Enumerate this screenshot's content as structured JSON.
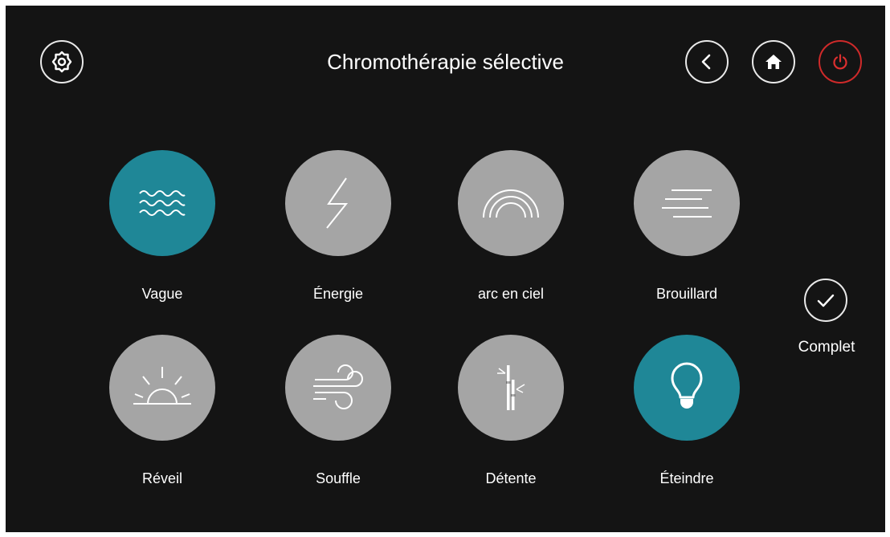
{
  "header": {
    "title": "Chromothérapie sélective"
  },
  "top_buttons": {
    "settings_icon": "gear-icon",
    "back_icon": "chevron-left-icon",
    "home_icon": "home-icon",
    "power_icon": "power-icon"
  },
  "modes": [
    {
      "label": "Vague",
      "icon": "waves-icon",
      "selected": true
    },
    {
      "label": "Énergie",
      "icon": "lightning-icon",
      "selected": false
    },
    {
      "label": "arc en ciel",
      "icon": "rainbow-icon",
      "selected": false
    },
    {
      "label": "Brouillard",
      "icon": "fog-icon",
      "selected": false
    },
    {
      "label": "Réveil",
      "icon": "sunrise-icon",
      "selected": false
    },
    {
      "label": "Souffle",
      "icon": "wind-icon",
      "selected": false
    },
    {
      "label": "Détente",
      "icon": "bamboo-icon",
      "selected": false
    },
    {
      "label": "Éteindre",
      "icon": "light-bulb-icon",
      "selected": true
    }
  ],
  "complete": {
    "label": "Complet",
    "icon": "check-icon"
  },
  "colors": {
    "background": "#141414",
    "selected": "#1f8797",
    "unselected": "#a5a5a5",
    "power": "#cf2a2a",
    "text": "#ffffff"
  }
}
